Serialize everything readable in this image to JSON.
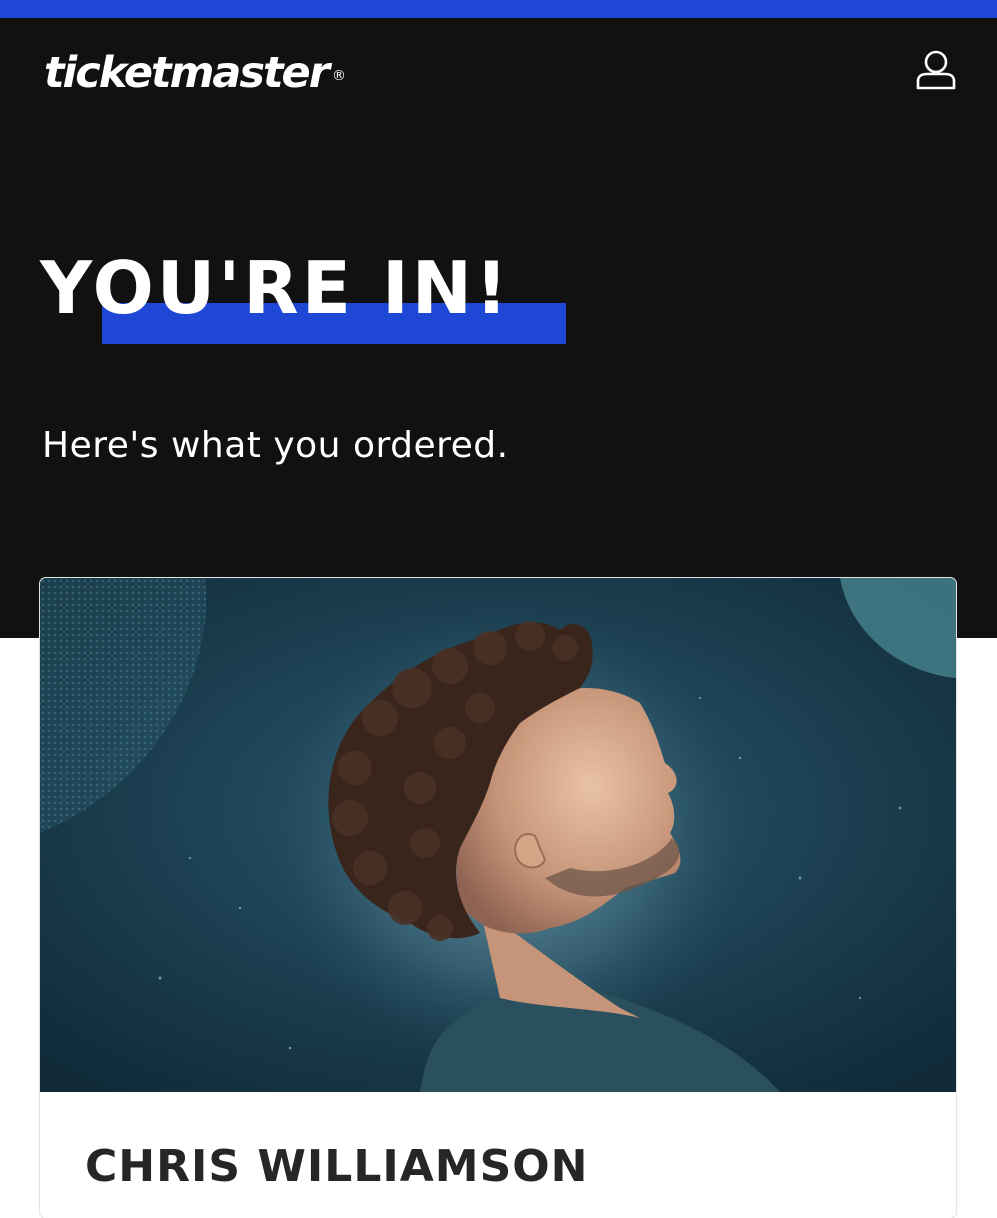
{
  "header": {
    "brand": "ticketmaster",
    "registered_mark": "®",
    "account_icon": "user-icon"
  },
  "confirmation": {
    "headline": "YOU'RE IN!",
    "subheadline": "Here's what you ordered."
  },
  "event": {
    "name": "CHRIS WILLIAMSON",
    "image_description_icon": "event-photo"
  },
  "colors": {
    "accent": "#1f47d6",
    "hero_background": "#111111",
    "image_background": "#1b3f50",
    "text_dark": "#262626"
  }
}
